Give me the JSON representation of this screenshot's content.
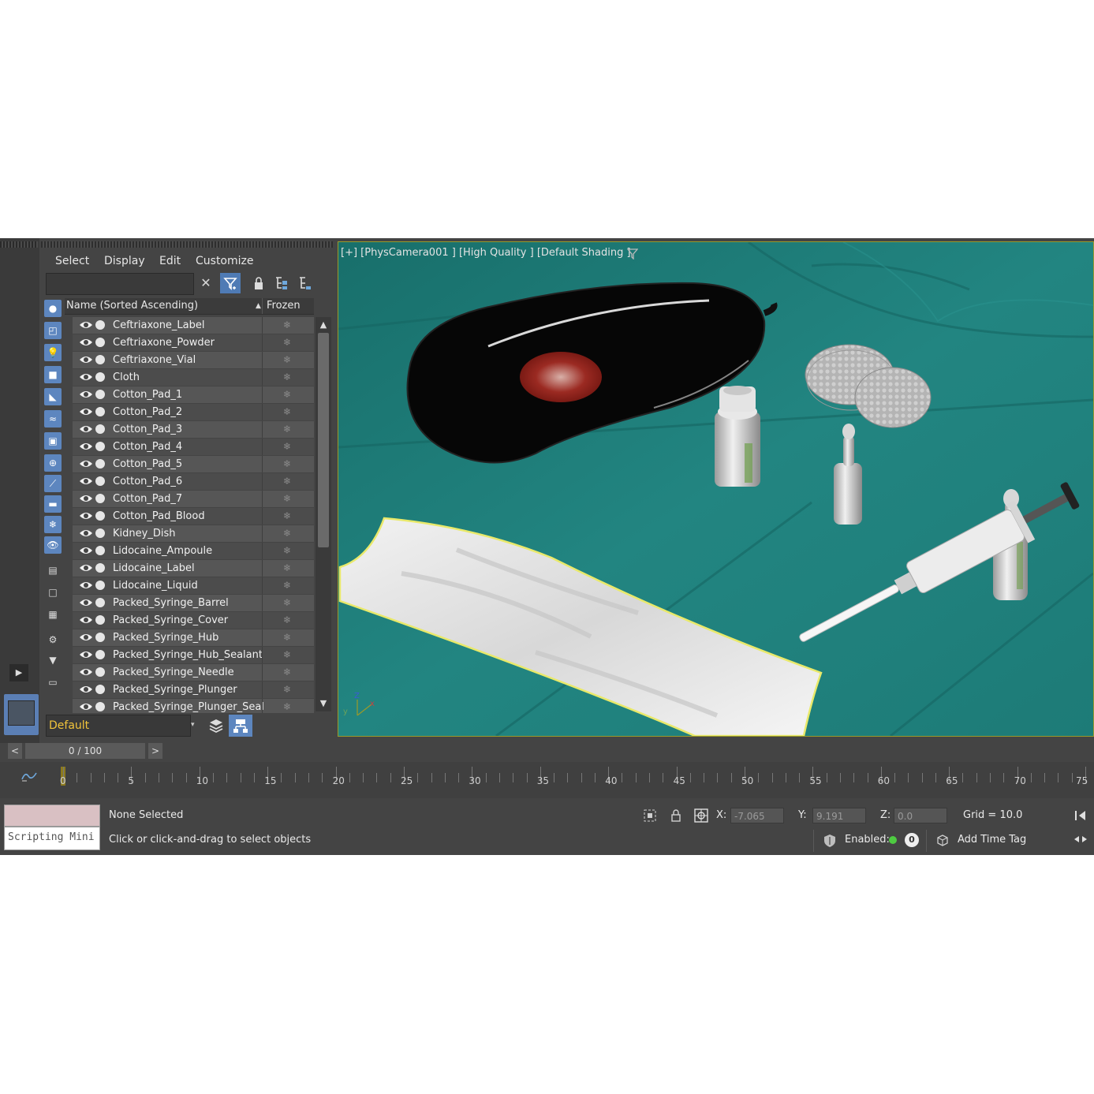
{
  "explorer": {
    "menu": [
      "Select",
      "Display",
      "Edit",
      "Customize"
    ],
    "search_value": "",
    "toolbar": [
      {
        "name": "clear-search-icon",
        "glyph": "✕"
      },
      {
        "name": "filter-icon",
        "glyph": "⏚"
      },
      {
        "name": "lock-icon",
        "glyph": "🔒"
      },
      {
        "name": "expand-hierarchy-icon",
        "glyph": "⊞"
      },
      {
        "name": "collapse-hierarchy-icon",
        "glyph": "⊟"
      }
    ],
    "side_icons": [
      {
        "name": "geometry-filter-icon",
        "glyph": "●",
        "on": true
      },
      {
        "name": "shapes-filter-icon",
        "glyph": "◰",
        "on": true
      },
      {
        "name": "lights-filter-icon",
        "glyph": "💡",
        "on": true
      },
      {
        "name": "cameras-filter-icon",
        "glyph": "■",
        "on": true
      },
      {
        "name": "helpers-filter-icon",
        "glyph": "◣",
        "on": true
      },
      {
        "name": "spacewarps-filter-icon",
        "glyph": "≈",
        "on": true
      },
      {
        "name": "groups-filter-icon",
        "glyph": "▣",
        "on": true
      },
      {
        "name": "xrefs-filter-icon",
        "glyph": "⊕",
        "on": true
      },
      {
        "name": "bones-filter-icon",
        "glyph": "⟋",
        "on": true
      },
      {
        "name": "containers-filter-icon",
        "glyph": "▬",
        "on": true
      },
      {
        "name": "frozen-filter-icon",
        "glyph": "❄",
        "on": true
      },
      {
        "name": "hidden-filter-icon",
        "glyph": "👁",
        "on": true
      },
      {
        "name": "select-all-icon",
        "glyph": "▤",
        "on": false
      },
      {
        "name": "select-none-icon",
        "glyph": "□",
        "on": false
      },
      {
        "name": "invert-selection-icon",
        "glyph": "▦",
        "on": false
      },
      {
        "name": "filter-settings-icon",
        "glyph": "⚙",
        "on": false
      },
      {
        "name": "funnel-icon",
        "glyph": "▼",
        "on": false
      },
      {
        "name": "clapper-icon",
        "glyph": "▭",
        "on": false
      }
    ],
    "column_name": "Name (Sorted Ascending)",
    "column_frozen": "Frozen",
    "objects": [
      "Ceftriaxone_Label",
      "Ceftriaxone_Powder",
      "Ceftriaxone_Vial",
      "Cloth",
      "Cotton_Pad_1",
      "Cotton_Pad_2",
      "Cotton_Pad_3",
      "Cotton_Pad_4",
      "Cotton_Pad_5",
      "Cotton_Pad_6",
      "Cotton_Pad_7",
      "Cotton_Pad_Blood",
      "Kidney_Dish",
      "Lidocaine_Ampoule",
      "Lidocaine_Label",
      "Lidocaine_Liquid",
      "Packed_Syringe_Barrel",
      "Packed_Syringe_Cover",
      "Packed_Syringe_Hub",
      "Packed_Syringe_Hub_Sealant",
      "Packed_Syringe_Needle",
      "Packed_Syringe_Plunger",
      "Packed_Syringe_Plunger_Seal"
    ],
    "frozen_glyph": "❄",
    "layer": "Default"
  },
  "viewport": {
    "label": "[+] [PhysCamera001 ] [High Quality ] [Default Shading ]",
    "colors": {
      "cloth": "#1f7e7a",
      "border": "#9a9a2a"
    }
  },
  "timeline": {
    "slider_text": "0 / 100",
    "prev": "<",
    "next": ">",
    "current_frame": 0,
    "ticks": [
      "0",
      "5",
      "10",
      "15",
      "20",
      "25",
      "30",
      "35",
      "40",
      "45",
      "50",
      "55",
      "60",
      "65",
      "70",
      "75"
    ]
  },
  "status": {
    "maxscript": "Scripting Mini",
    "line1": "None Selected",
    "line2": "Click or click-and-drag to select objects",
    "x_label": "X:",
    "x_value": "-7.065",
    "y_label": "Y:",
    "y_value": "9.191",
    "z_label": "Z:",
    "z_value": "0.0",
    "grid": "Grid = 10.0",
    "enabled_label": "Enabled:",
    "enabled_count": "0",
    "time_tag": "Add Time Tag",
    "accent_green": "#4ecb41"
  }
}
